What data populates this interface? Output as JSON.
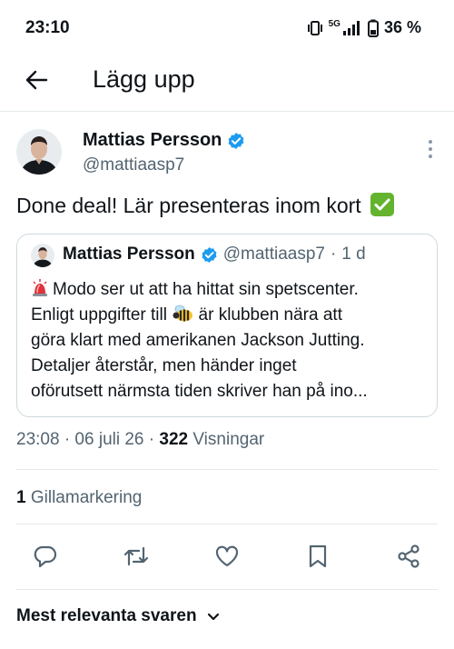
{
  "status_bar": {
    "time": "23:10",
    "network": "5G",
    "battery": "36 %",
    "icons": [
      "vibrate-icon",
      "signal-icon",
      "battery-icon"
    ]
  },
  "header": {
    "title": "Lägg upp",
    "back_icon": "arrow-left-icon"
  },
  "post": {
    "author_name": "Mattias Persson",
    "author_handle": "@mattiaasp7",
    "verified": true,
    "text": "Done deal! Lär presenteras inom kort",
    "text_emoji": "check-mark-button-emoji",
    "quote": {
      "author_name": "Mattias Persson",
      "author_handle": "@mattiaasp7",
      "separator": "·",
      "time": "1 d",
      "lines": [
        "Modo ser ut att ha hittat sin spetscenter.",
        "Enligt uppgifter till",
        "är klubben nära att",
        "göra klart med amerikanen Jackson Jutting.",
        "Detaljer återstår, men händer inget",
        "oförutsett närmsta tiden skriver han på ino..."
      ]
    },
    "timestamp": "23:08 · 06 juli 26 · ",
    "views_count": "322",
    "views_label": " Visningar",
    "likes_count": "1",
    "likes_label": " Gillamarkering"
  },
  "actions": {
    "icons": [
      "reply-icon",
      "repost-icon",
      "like-icon",
      "bookmark-icon",
      "share-icon"
    ]
  },
  "replies_sort": {
    "label": "Mest relevanta svaren"
  },
  "colors": {
    "text": "#0f1419",
    "secondary": "#536471",
    "verified": "#1d9bf0",
    "border": "#cfd9de",
    "divider": "#e6e9eb"
  }
}
